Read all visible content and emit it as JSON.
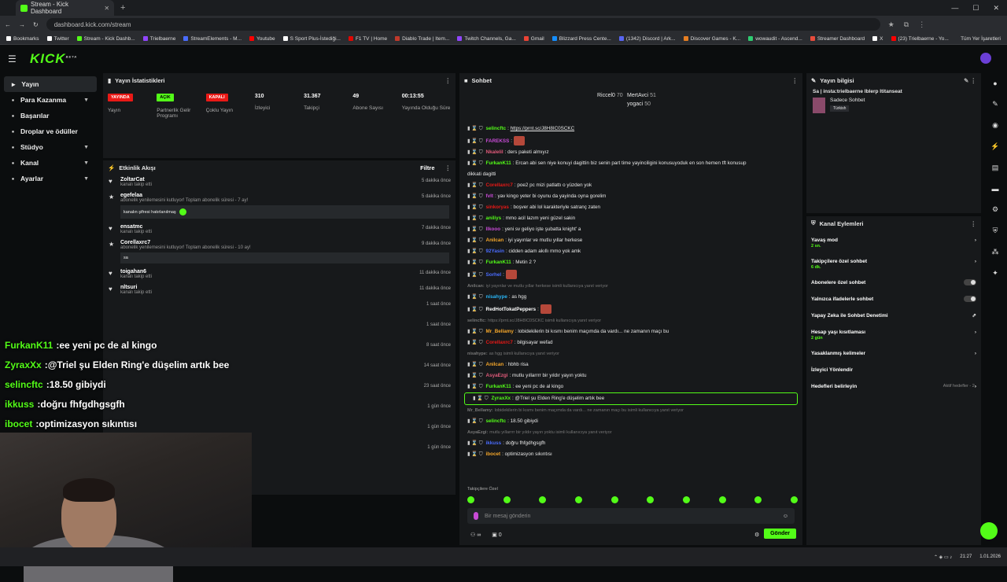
{
  "browser": {
    "tab_title": "Stream - Kick Dashboard",
    "url": "dashboard.kick.com/stream",
    "all_bookmarks": "Tüm Yer İşaretleri",
    "bookmarks": [
      {
        "label": "Bookmarks",
        "color": "#fff"
      },
      {
        "label": "Twitter",
        "color": "#fff"
      },
      {
        "label": "Stream - Kick Dashb...",
        "color": "#53fc18"
      },
      {
        "label": "Trielbaerne",
        "color": "#9146ff"
      },
      {
        "label": "StreamElements - M...",
        "color": "#4a6cff"
      },
      {
        "label": "Youtube",
        "color": "#ff0000"
      },
      {
        "label": "S Sport Plus-İstediği...",
        "color": "#fff"
      },
      {
        "label": "F1 TV | Home",
        "color": "#e10600"
      },
      {
        "label": "Diablo Trade | Item...",
        "color": "#c0392b"
      },
      {
        "label": "Twitch Channels, Ga...",
        "color": "#9146ff"
      },
      {
        "label": "Gmail",
        "color": "#ea4335"
      },
      {
        "label": "Blizzard Press Cente...",
        "color": "#148eff"
      },
      {
        "label": "(1342) Discord | Ark...",
        "color": "#5865f2"
      },
      {
        "label": "Discover Games - K...",
        "color": "#e67e22"
      },
      {
        "label": "wowaudit - Ascend...",
        "color": "#2ecc71"
      },
      {
        "label": "Streamer Dashboard",
        "color": "#e74c3c"
      },
      {
        "label": "X",
        "color": "#fff"
      },
      {
        "label": "(23) Trielbaerne - Yo...",
        "color": "#ff0000"
      }
    ]
  },
  "sidebar": {
    "items": [
      {
        "label": "Yayın"
      },
      {
        "label": "Para Kazanma"
      },
      {
        "label": "Başarılar"
      },
      {
        "label": "Droplar ve ödüller"
      },
      {
        "label": "Stüdyo"
      },
      {
        "label": "Kanal"
      },
      {
        "label": "Ayarlar"
      }
    ]
  },
  "stats": {
    "title": "Yayın İstatistikleri",
    "items": [
      {
        "badge": "YAYINDA",
        "badge_color": "#e91916",
        "label": "Yayın"
      },
      {
        "badge": "AÇIK",
        "badge_color": "#53fc18",
        "label": "Partnerlik Gelir Programı"
      },
      {
        "badge": "KAPALI",
        "badge_color": "#e91916",
        "label": "Çoklu Yayın"
      },
      {
        "value": "310",
        "label": "İzleyici"
      },
      {
        "value": "31.367",
        "label": "Takipçi"
      },
      {
        "value": "49",
        "label": "Abone Sayısı"
      },
      {
        "value": "00:13:55",
        "label": "Yayında Olduğu Süre"
      }
    ]
  },
  "feed": {
    "title": "Etkinlik Akışı",
    "filter": "Filtre",
    "events": [
      {
        "name": "ZoltarCat",
        "sub": "kanalı takip etti",
        "time": "5 dakika önce",
        "icon": "♥"
      },
      {
        "name": "egefelaa",
        "sub": "abonelik yenilemesini kutluyor! Toplam abonelik süresi - 7 ay!",
        "time": "5 dakika önce",
        "icon": "★",
        "box": "kanalın şifresi hatırlanılmaş"
      },
      {
        "name": "ensatmc",
        "sub": "kanalı takip etti",
        "time": "7 dakika önce",
        "icon": "♥"
      },
      {
        "name": "Corellaxrc7",
        "sub": "abonelik yenilemesini kutluyor! Toplam abonelik süresi - 10 ay!",
        "time": "9 dakika önce",
        "icon": "★",
        "box": "sa"
      },
      {
        "name": "toigahan6",
        "sub": "kanalı takip etti",
        "time": "11 dakika önce",
        "icon": "♥"
      },
      {
        "name": "nltsuri",
        "sub": "kanalı takip etti",
        "time": "11 dakika önce",
        "icon": "♥"
      },
      {
        "name": "",
        "sub": "",
        "time": "1 saat önce",
        "icon": ""
      },
      {
        "name": "",
        "sub": "",
        "time": "1 saat önce",
        "icon": ""
      },
      {
        "name": "",
        "sub": "",
        "time": "8 saat önce",
        "icon": ""
      },
      {
        "name": "",
        "sub": "",
        "time": "14 saat önce",
        "icon": ""
      },
      {
        "name": "",
        "sub": "",
        "time": "23 saat önce",
        "icon": ""
      },
      {
        "name": "",
        "sub": "",
        "time": "1 gün önce",
        "icon": ""
      },
      {
        "name": "",
        "sub": "",
        "time": "1 gün önce",
        "icon": ""
      },
      {
        "name": "",
        "sub": "",
        "time": "1 gün önce",
        "icon": ""
      }
    ]
  },
  "chat": {
    "title": "Sohbet",
    "pinned": [
      {
        "name": "Riccel0",
        "v": "70"
      },
      {
        "name": "MertAvci",
        "v": "51"
      },
      {
        "name": "yogaci",
        "v": "50"
      }
    ],
    "lines": [
      {
        "u": "selincftc",
        "c": "#53fc18",
        "t": "https://prnt.sc/J8H8IC0SCKC"
      },
      {
        "u": "FAREKSS",
        "c": "#c84bd6",
        "t": "",
        "emo": true
      },
      {
        "u": "Nkalelil",
        "c": "#e05a7a",
        "t": "ders paketi almıyız"
      },
      {
        "u": "FurkanK11",
        "c": "#53fc18",
        "t": "Ercan abi sen niye konuyi dagittin biz senin part time yayinciligini konusuyoduk en son hemen tft konusup"
      },
      {
        "u": "",
        "c": "#fff",
        "t": "dikkati dagitti"
      },
      {
        "u": "Corellaxrc7",
        "c": "#e91916",
        "t": "poe2 pc mizi patlattı o yüzden yok"
      },
      {
        "u": "fvlt",
        "c": "#c84bd6",
        "t": "yav kingo yeter bi oyunu da yayinda oyna gorelim"
      },
      {
        "u": "sinkoryas",
        "c": "#e91916",
        "t": "boşver abi lol karakteriyle satranç zaten"
      },
      {
        "u": "aniliys",
        "c": "#53fc18",
        "t": "mmo acil lazım yeni güzel sakin"
      },
      {
        "u": "Ilkooo",
        "c": "#c84bd6",
        "t": "yeni sv geliyo işte şubatta knight' a"
      },
      {
        "u": "Anilcan",
        "c": "#f4a62a",
        "t": "iyi yayınlar ve mutlu yıllar herkese"
      },
      {
        "u": "92Yasin",
        "c": "#4a6cff",
        "t": "cidden adam akıllı mmo yok amk"
      },
      {
        "u": "FurkanK11",
        "c": "#53fc18",
        "t": "Metin 2 ?"
      },
      {
        "u": "Sorhel",
        "c": "#4a6cff",
        "t": "",
        "emo": true
      },
      {
        "u": "Anilcan:",
        "c": "#777",
        "t": "iyi yayınlar ve mutlu yıllar herkese isimli kullanıcıya yanıt veriyor",
        "rep": true
      },
      {
        "u": "nisahype",
        "c": "#2ab4f4",
        "t": "as hgg"
      },
      {
        "u": "RedHotTokatPeppers",
        "c": "#fff",
        "t": "",
        "emo": true
      },
      {
        "u": "selincftc:",
        "c": "#777",
        "t": "https://prnt.sc/J8H8IC0SCKC isimli kullanıcıya yanıt veriyor",
        "rep": true
      },
      {
        "u": "Mr_Bellamy",
        "c": "#f4a62a",
        "t": "lobidekilerin bi kısmı benim maçımda da vardı... ne zamanın maçı bu"
      },
      {
        "u": "Corellaxrc7",
        "c": "#e91916",
        "t": "bilgisayar wefad"
      },
      {
        "u": "nisahype:",
        "c": "#777",
        "t": "as hgg isimli kullanıcıya yanıt veriyor",
        "rep": true
      },
      {
        "u": "Anilcan",
        "c": "#f4a62a",
        "t": "hbhb risa"
      },
      {
        "u": "AsyaEzgi",
        "c": "#e05a7a",
        "t": "mutlu yıllarrrr bir yıldır yayın yoktu"
      },
      {
        "u": "FurkanK11",
        "c": "#53fc18",
        "t": "ee yeni pc de al kingo"
      },
      {
        "u": "ZyraxXx",
        "c": "#53fc18",
        "t": "@Triel şu Elden Ring'e düşelim artık bee",
        "hl": true
      },
      {
        "u": "Mr_Bellamy:",
        "c": "#777",
        "t": "lobidekilerin bi kısmı benim maçımda da vardı... ne zamanın maçı bu isimli kullanıcıya yanıt veriyor",
        "rep": true
      },
      {
        "u": "selincftc",
        "c": "#53fc18",
        "t": "18.50 gibiydi"
      },
      {
        "u": "AsyaEzgi:",
        "c": "#777",
        "t": "mutlu yıllarrrr bir yıldır yayın yoktu isimli kullanıcıya yanıt veriyor",
        "rep": true
      },
      {
        "u": "ikkuss",
        "c": "#4a6cff",
        "t": "doğru fhfgdhgsgfh"
      },
      {
        "u": "ibocet",
        "c": "#f4a62a",
        "t": "optimizasyon sıkıntısı"
      }
    ],
    "followers_only": "Takipçilere Özel",
    "placeholder": "Bir mesaj gönderin",
    "send": "Gönder",
    "count": "0"
  },
  "info": {
    "title": "Yayın bilgisi",
    "stream_title": "Sa | insta:trielbaerne Iblerp Ititanseat",
    "category": "Sadece Sohbet",
    "tag": "Türkish"
  },
  "actions": {
    "title": "Kanal Eylemleri",
    "items": [
      {
        "label": "Yavaş mod",
        "sub": "2 sn.",
        "type": "arrow"
      },
      {
        "label": "Takipçilere özel sohbet",
        "sub": "6 dk.",
        "type": "arrow"
      },
      {
        "label": "Abonelere özel sohbet",
        "sub": "",
        "type": "toggle"
      },
      {
        "label": "Yalnızca ifadelerle sohbet",
        "sub": "",
        "type": "toggle"
      },
      {
        "label": "Yapay Zeka ile Sohbet Denetimi",
        "sub": "",
        "type": "ext"
      },
      {
        "label": "Hesap yaşı kısıtlaması",
        "sub": "2 gün",
        "type": "arrow"
      },
      {
        "label": "Yasaklanmış kelimeler",
        "sub": "",
        "type": "arrow"
      },
      {
        "label": "İzleyici Yönlendir",
        "sub": "",
        "type": "none"
      },
      {
        "label": "Hedefleri belirleyin",
        "sub": "",
        "type": "goal",
        "extra": "Aktif hedefler - 2"
      }
    ]
  },
  "overlay": [
    {
      "u": "FurkanK11",
      "t": "ee yeni pc de al kingo"
    },
    {
      "u": "ZyraxXx",
      "t": "@Triel şu Elden Ring'e düşelim artık bee"
    },
    {
      "u": "selincftc",
      "t": "18.50 gibiydi"
    },
    {
      "u": "ikkuss",
      "t": "doğru fhfgdhgsgfh"
    },
    {
      "u": "ibocet",
      "t": "optimizasyon sıkıntısı"
    }
  ],
  "taskbar": {
    "time": "21:27",
    "date": "1.01.2026"
  }
}
